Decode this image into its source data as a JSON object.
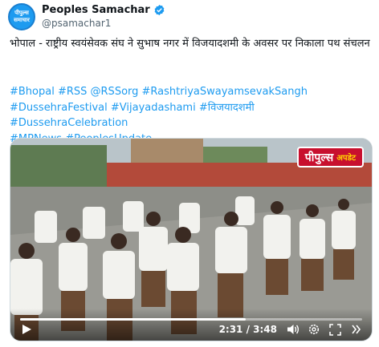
{
  "account": {
    "display_name": "Peoples Samachar",
    "handle": "@psamachar1",
    "avatar_line1": "पीपुल्स",
    "avatar_line2": "समाचार",
    "verified_icon": "verified-badge-icon"
  },
  "tweet": {
    "text": "भोपाल - राष्ट्रीय स्वयंसेवक संघ ने सुभाष नगर में विजयादशमी के अवसर पर निकाला पथ संचलन",
    "hashtags_line1": "#Bhopal #RSS @RSSorg #RashtriyaSwayamsevakSangh",
    "hashtags_line2": "#DussehraFestival #Vijayadashami #विजयादशमी #DussehraCelebration",
    "hashtags_line3": "#MPNews #PeoplesUpdate"
  },
  "video": {
    "channel_brand": "पीपुल्स",
    "channel_tag": "अपडेट",
    "time": "2:31 / 3:48",
    "progress": 0.66,
    "controls": [
      "play-icon",
      "speaker-icon",
      "settings-icon",
      "fullscreen-icon",
      "more-icon"
    ]
  },
  "colors": {
    "link": "#1d9bf0",
    "text": "#0f1419",
    "secondary": "#536471",
    "brand_red": "#c8102e"
  }
}
